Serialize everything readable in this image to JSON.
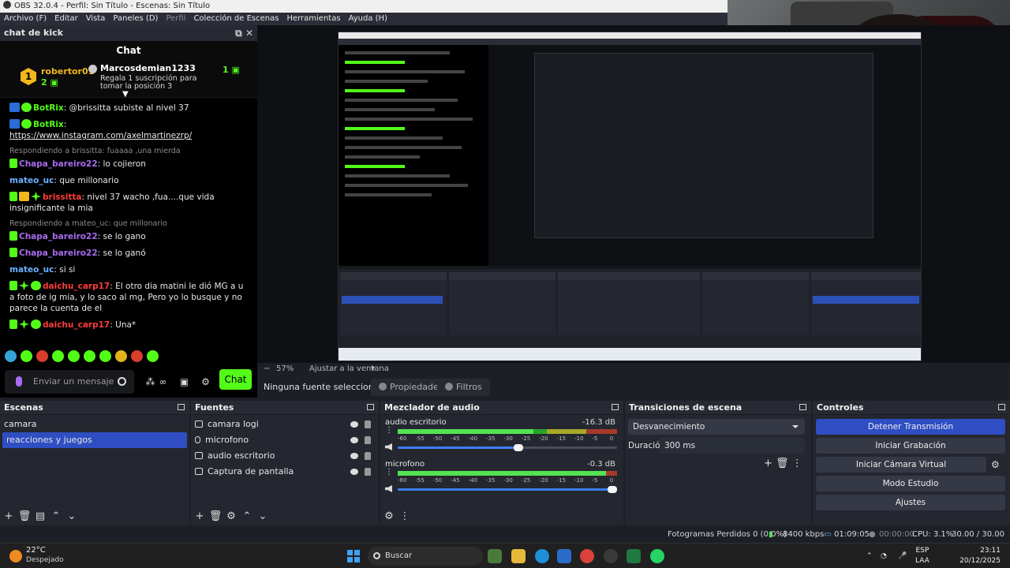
{
  "title_bar": {
    "text": "OBS 32.0.4 - Perfil: Sin Título - Escenas: Sin Título"
  },
  "menu": [
    "Archivo (F)",
    "Editar",
    "Vista",
    "Paneles (D)",
    "Perfil",
    "Colección de Escenas",
    "Herramientas",
    "Ayuda (H)"
  ],
  "chat_dock": {
    "title": "chat de kick",
    "header": "Chat",
    "pinned": {
      "rank": "1",
      "user": "robertor01",
      "count": "2",
      "gifter": "Marcosdemian1233",
      "message": "Regala 1 suscripción para tomar la posición 3",
      "gift_count": "1"
    },
    "messages": [
      {
        "user": "BotRix",
        "sep": ": ",
        "text": "@brissitta subiste al nivel 37",
        "color": "#53fc18",
        "badges": [
          "ver",
          "ok"
        ]
      },
      {
        "user": "BotRix",
        "sep": ": ",
        "text": "https://www.instagram.com/axelmartinezrp/",
        "color": "#53fc18",
        "badges": [
          "ver",
          "ok"
        ]
      },
      {
        "reply": "Respondiendo a brissitta: fuaaaa ,una mierda",
        "user": "Chapa_bareiro22",
        "sep": ": ",
        "text": "lo cojieron",
        "color": "#a86cf0",
        "badges": [
          "sub"
        ]
      },
      {
        "user": "mateo_uc",
        "sep": ": ",
        "text": "que millonario",
        "color": "#6ab2ff",
        "badges": []
      },
      {
        "user": "brissitta",
        "sep": ": ",
        "text": "nivel 37 wacho ,fua....que vida insignificante la mia",
        "color": "#ff3b3b",
        "badges": [
          "sub",
          "crown",
          "spark"
        ]
      },
      {
        "reply": "Respondiendo a mateo_uc: que millonario",
        "user": "Chapa_bareiro22",
        "sep": ": ",
        "text": "se lo gano",
        "color": "#a86cf0",
        "badges": [
          "sub"
        ]
      },
      {
        "user": "Chapa_bareiro22",
        "sep": ": ",
        "text": "se lo ganó",
        "color": "#a86cf0",
        "badges": [
          "sub"
        ]
      },
      {
        "user": "mateo_uc",
        "sep": ": ",
        "text": "si si",
        "color": "#6ab2ff",
        "badges": []
      },
      {
        "user": "daichu_carp17",
        "sep": ": ",
        "text": "El otro dia matini le dió MG a u a foto de ig mia, y lo saco al mg, Pero yo lo busque y no parece la cuenta de el",
        "color": "#ff3b3b",
        "badges": [
          "sub",
          "spark",
          "ok"
        ]
      },
      {
        "user": "daichu_carp17",
        "sep": ": ",
        "text": "Una*",
        "color": "#ff3b3b",
        "badges": [
          "sub",
          "spark",
          "ok"
        ]
      }
    ],
    "input_placeholder": "Enviar un mensaje",
    "send_label": "Chat"
  },
  "preview": {
    "zoom": "57%",
    "fit_label": "Ajustar a la ventana"
  },
  "source_toolbar": {
    "none_label": "Ninguna fuente seleccionad",
    "properties": "Propiedades",
    "filters": "Filtros"
  },
  "scenes": {
    "title": "Escenas",
    "items": [
      "camara",
      "reacciones y juegos"
    ],
    "selected": 1
  },
  "sources": {
    "title": "Fuentes",
    "items": [
      "camara logi",
      "microfono",
      "audio escritorio",
      "Captura de pantalla"
    ]
  },
  "mixer": {
    "title": "Mezclador de audio",
    "channels": [
      {
        "name": "audio escritorio",
        "db": "-16.3 dB",
        "level": 0.62,
        "volume": 0.55
      },
      {
        "name": "microfono",
        "db": "-0.3 dB",
        "level": 0.95,
        "volume": 0.98
      }
    ],
    "scale": [
      "-60",
      "-55",
      "-50",
      "-45",
      "-40",
      "-35",
      "-30",
      "-25",
      "-20",
      "-15",
      "-10",
      "-5",
      "0"
    ]
  },
  "transitions": {
    "title": "Transiciones de escena",
    "selected": "Desvanecimiento",
    "duration_label": "Duración",
    "duration": "300 ms"
  },
  "controls": {
    "title": "Controles",
    "buttons": [
      "Detener Transmisión",
      "Iniciar Grabación",
      "Iniciar Cámara Virtual",
      "Modo Estudio",
      "Ajustes"
    ]
  },
  "status": {
    "frames": "Fotogramas Perdidos 0 (0.0%)",
    "bitrate": "8400 kbps",
    "stream_time": "01:09:05",
    "rec_time": "00:00:00",
    "cpu": "CPU: 3.1%",
    "fps": "30.00 / 30.00 FPS"
  },
  "taskbar": {
    "temp": "22°C",
    "weather": "Despejado",
    "search": "Buscar",
    "lang1": "ESP",
    "lang2": "LAA",
    "time": "23:11",
    "date": "20/12/2025"
  },
  "colors": {
    "accent": "#2f4ec3",
    "kick_green": "#53fc18",
    "bg": "#1d1f26"
  }
}
